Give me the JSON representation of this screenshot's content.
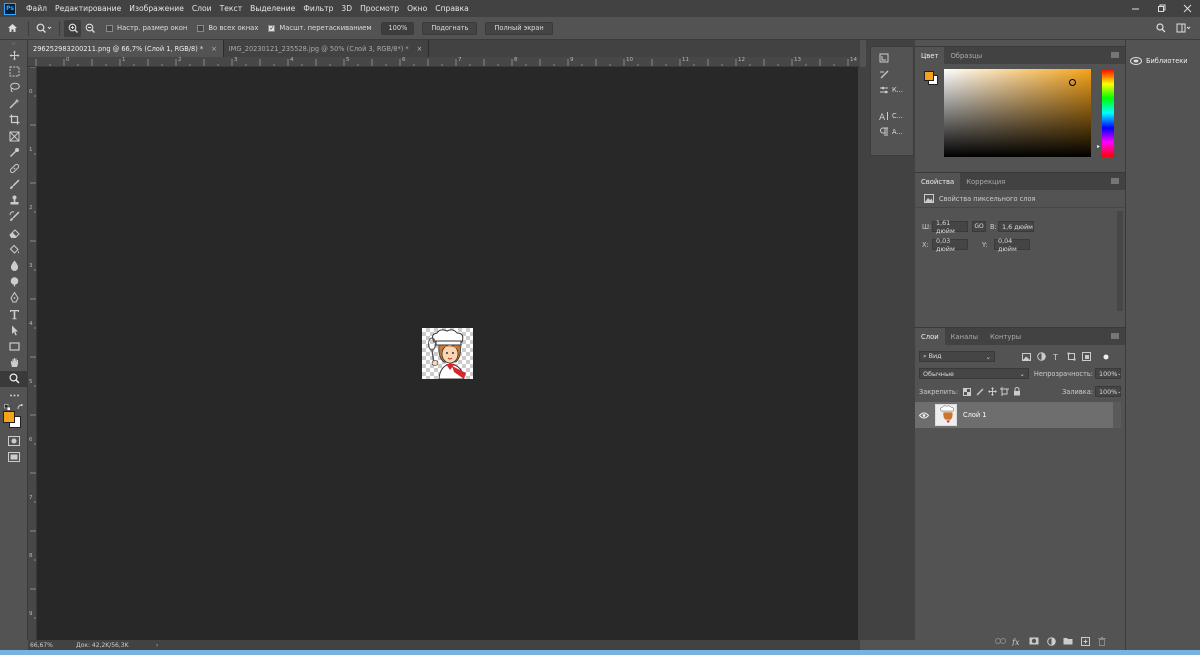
{
  "app": {
    "logo": "Ps",
    "accent": "#31a8ff"
  },
  "menu": [
    "Файл",
    "Редактирование",
    "Изображение",
    "Слои",
    "Текст",
    "Выделение",
    "Фильтр",
    "3D",
    "Просмотр",
    "Окно",
    "Справка"
  ],
  "options": {
    "fit_window": "Настр. размер окон",
    "all_windows": "Во всех окнах",
    "scrubby": "Масшт. перетаскиванием",
    "zoom_value": "100%",
    "fit_button": "Подогнать",
    "fullscreen_button": "Полный экран"
  },
  "tabs": [
    {
      "label": "296252983200211.png @ 66,7% (Слой 1, RGB/8) *",
      "close": "×",
      "active": true
    },
    {
      "label": "IMG_20230121_235528.jpg @ 50% (Слой 3, RGB/8*) *",
      "close": "×",
      "active": false
    }
  ],
  "ruler_top": [
    "0",
    "1",
    "2",
    "3",
    "4",
    "5",
    "6",
    "7",
    "8",
    "9",
    "10",
    "11",
    "12",
    "13",
    "14"
  ],
  "ruler_left": [
    "0",
    "1",
    "2",
    "3",
    "4",
    "5",
    "6",
    "7",
    "8",
    "9"
  ],
  "status": {
    "zoom": "66,67%",
    "doc": "Док: 42,2K/56,3K",
    "arrow": "›"
  },
  "mid": {
    "brush_settings": "К...",
    "char": "С...",
    "para": "А..."
  },
  "color_panel": {
    "tabs": [
      "Цвет",
      "Образцы"
    ],
    "foreground": "#f5a31a",
    "background": "#ffffff"
  },
  "properties": {
    "tabs": [
      "Свойства",
      "Коррекция"
    ],
    "section": "Свойства пиксельного слоя",
    "w_label": "Ш:",
    "w": "1,61 дюйм",
    "link": "GO",
    "h_label": "В:",
    "h": "1,6 дюйм",
    "x_label": "X:",
    "x": "0,03 дюйм",
    "y_label": "Y:",
    "y": "0,04 дюйм"
  },
  "layers": {
    "tabs": [
      "Слои",
      "Каналы",
      "Контуры"
    ],
    "filter": "Вид",
    "blend": "Обычные",
    "opacity_label": "Непрозрачность:",
    "opacity": "100%",
    "lock_label": "Закрепить:",
    "fill_label": "Заливка:",
    "fill": "100%",
    "items": [
      {
        "name": "Слой 1",
        "visible": true
      }
    ]
  },
  "libraries": "Библиотеки"
}
